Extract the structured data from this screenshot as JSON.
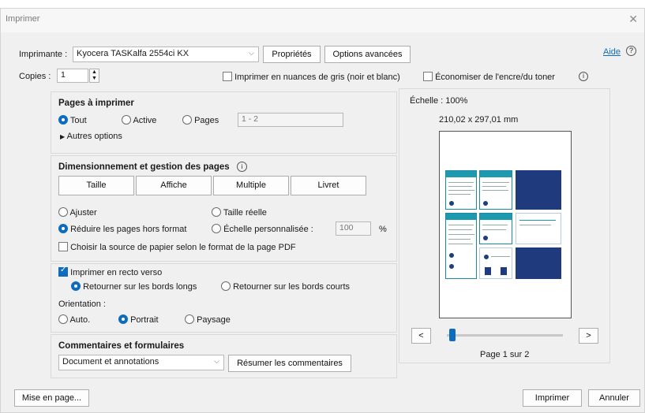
{
  "window": {
    "title": "Imprimer",
    "close_glyph": "✕"
  },
  "printer": {
    "label": "Imprimante :",
    "selected": "Kyocera TASKalfa 2554ci KX",
    "properties_button": "Propriétés",
    "advanced_button": "Options avancées",
    "help_link": "Aide",
    "help_icon": "?"
  },
  "copies": {
    "label": "Copies :",
    "value": "1"
  },
  "options": {
    "grayscale": "Imprimer en nuances de gris (noir et blanc)",
    "save_ink": "Économiser de l'encre/du toner",
    "info_icon": "i"
  },
  "pages": {
    "title": "Pages à imprimer",
    "all": "Tout",
    "active": "Active",
    "pages": "Pages",
    "range_placeholder": "1 - 2",
    "more": "Autres options"
  },
  "sizing": {
    "title": "Dimensionnement et gestion des pages",
    "info_icon": "i",
    "tabs": [
      "Taille",
      "Affiche",
      "Multiple",
      "Livret"
    ],
    "fit": "Ajuster",
    "actual": "Taille réelle",
    "shrink": "Réduire les pages hors format",
    "custom": "Échelle personnalisée :",
    "custom_value": "100",
    "custom_unit": "%",
    "paper_source": "Choisir la source de papier selon le format de la page PDF"
  },
  "duplex": {
    "label": "Imprimer en recto verso",
    "long_edge": "Retourner sur les bords longs",
    "short_edge": "Retourner sur les bords courts",
    "orientation_label": "Orientation :",
    "auto": "Auto.",
    "portrait": "Portrait",
    "landscape": "Paysage"
  },
  "comments": {
    "title": "Commentaires et formulaires",
    "selected": "Document et annotations",
    "summarize_button": "Résumer les commentaires"
  },
  "preview": {
    "scale": "Échelle : 100%",
    "size": "210,02 x 297,01 mm",
    "prev": "<",
    "next": ">",
    "page_indicator": "Page 1 sur 2",
    "page_position": 0.0
  },
  "footer": {
    "page_setup_button": "Mise en page...",
    "print_button": "Imprimer",
    "cancel_button": "Annuler"
  },
  "colors": {
    "accent": "#0f6cbd",
    "annotation_arrow": "#1aa3a3"
  }
}
